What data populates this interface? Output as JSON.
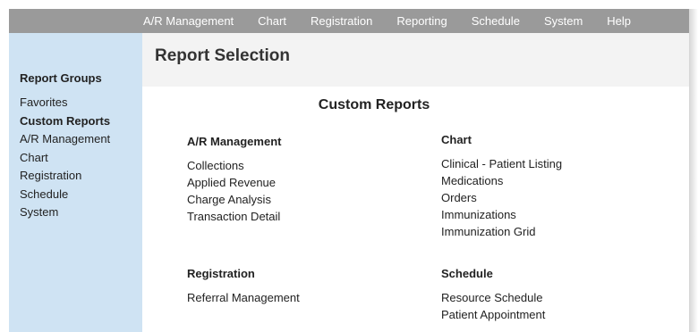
{
  "menu": [
    "A/R Management",
    "Chart",
    "Registration",
    "Reporting",
    "Schedule",
    "System",
    "Help"
  ],
  "sidebar": {
    "heading": "Report Groups",
    "items": [
      {
        "label": "Favorites",
        "active": false
      },
      {
        "label": "Custom Reports",
        "active": true
      },
      {
        "label": "A/R Management",
        "active": false
      },
      {
        "label": "Chart",
        "active": false
      },
      {
        "label": "Registration",
        "active": false
      },
      {
        "label": "Schedule",
        "active": false
      },
      {
        "label": "System",
        "active": false
      }
    ]
  },
  "page": {
    "title": "Report Selection"
  },
  "main": {
    "section_title": "Custom Reports",
    "groups": {
      "ar": {
        "title": "A/R Management",
        "items": [
          "Collections",
          "Applied Revenue",
          "Charge Analysis",
          "Transaction Detail"
        ]
      },
      "chart": {
        "title": "Chart",
        "items": [
          "Clinical - Patient Listing",
          "Medications",
          "Orders",
          "Immunizations",
          "Immunization Grid"
        ]
      },
      "registration": {
        "title": "Registration",
        "items": [
          "Referral Management"
        ]
      },
      "schedule": {
        "title": "Schedule",
        "items": [
          "Resource Schedule",
          "Patient Appointment"
        ]
      }
    }
  },
  "colors": {
    "topbar": "#9a9a9a",
    "sidebar": "#cfe3f3",
    "header_band": "#f3f3f3"
  }
}
